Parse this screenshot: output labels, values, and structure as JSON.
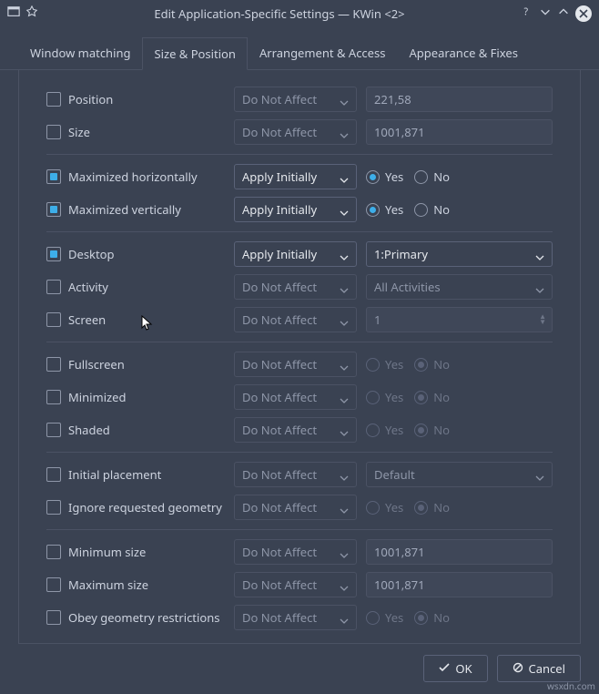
{
  "window": {
    "title": "Edit Application-Specific Settings — KWin <2>"
  },
  "tabs": [
    "Window matching",
    "Size & Position",
    "Arrangement & Access",
    "Appearance & Fixes"
  ],
  "activeTab": 1,
  "policy": {
    "doNotAffect": "Do Not Affect",
    "applyInitially": "Apply Initially"
  },
  "radio": {
    "yes": "Yes",
    "no": "No"
  },
  "rows": {
    "position": {
      "label": "Position",
      "value": "221,58"
    },
    "size": {
      "label": "Size",
      "value": "1001,871"
    },
    "maxH": {
      "label": "Maximized horizontally"
    },
    "maxV": {
      "label": "Maximized vertically"
    },
    "desktop": {
      "label": "Desktop",
      "value": "1:Primary"
    },
    "activity": {
      "label": "Activity",
      "value": "All Activities"
    },
    "screen": {
      "label": "Screen",
      "value": "1"
    },
    "fullscreen": {
      "label": "Fullscreen"
    },
    "minimized": {
      "label": "Minimized"
    },
    "shaded": {
      "label": "Shaded"
    },
    "initialPl": {
      "label": "Initial placement",
      "value": "Default"
    },
    "ignoreGeo": {
      "label": "Ignore requested geometry"
    },
    "minSize": {
      "label": "Minimum size",
      "value": "1001,871"
    },
    "maxSize": {
      "label": "Maximum size",
      "value": "1001,871"
    },
    "obeyGeo": {
      "label": "Obey geometry restrictions"
    }
  },
  "buttons": {
    "ok": "OK",
    "cancel": "Cancel"
  },
  "watermark": "wsxdn.com"
}
